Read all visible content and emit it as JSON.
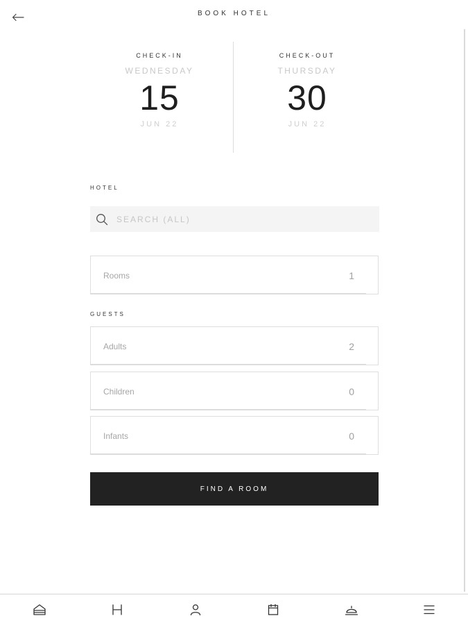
{
  "header": {
    "title": "BOOK HOTEL",
    "back_icon": "arrow-left-icon"
  },
  "checkin": {
    "label": "CHECK-IN",
    "weekday": "WEDNESDAY",
    "day": "15",
    "month_year": "JUN 22"
  },
  "checkout": {
    "label": "CHECK-OUT",
    "weekday": "THURSDAY",
    "day": "30",
    "month_year": "JUN 22"
  },
  "hotel": {
    "section_label": "HOTEL",
    "search_placeholder": "SEARCH (ALL)",
    "search_value": "",
    "search_icon": "search-icon"
  },
  "rooms": {
    "label": "Rooms",
    "value": "1"
  },
  "guests": {
    "section_label": "GUESTS",
    "adults": {
      "label": "Adults",
      "value": "2"
    },
    "children": {
      "label": "Children",
      "value": "0"
    },
    "infants": {
      "label": "Infants",
      "value": "0"
    }
  },
  "find_button": {
    "label": "FIND A ROOM"
  },
  "tabbar": {
    "items": [
      {
        "icon": "home-icon"
      },
      {
        "icon": "hotel-icon"
      },
      {
        "icon": "profile-icon"
      },
      {
        "icon": "calendar-icon"
      },
      {
        "icon": "room-service-icon"
      },
      {
        "icon": "menu-icon"
      }
    ]
  },
  "colors": {
    "accent": "#222222",
    "background": "#ffffff",
    "muted_text": "#c8c8c8",
    "field_border": "#dedede",
    "search_bg": "#f4f4f4"
  }
}
